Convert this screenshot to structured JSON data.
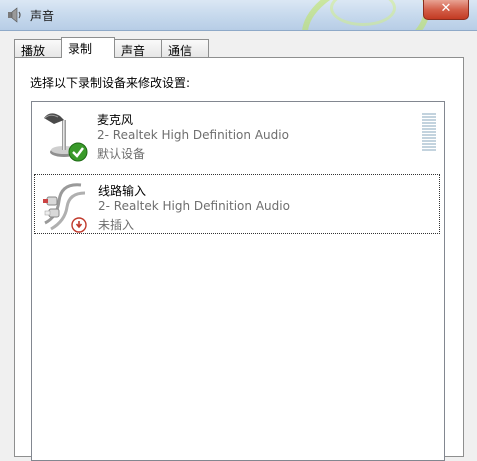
{
  "window": {
    "title": "声音",
    "close_label": "✕"
  },
  "tabs": [
    {
      "label": "播放",
      "active": false
    },
    {
      "label": "录制",
      "active": true
    },
    {
      "label": "声音",
      "active": false
    },
    {
      "label": "通信",
      "active": false
    }
  ],
  "instruction": "选择以下录制设备来修改设置:",
  "devices": [
    {
      "name": "麦克风",
      "description": "2- Realtek High Definition Audio",
      "status": "默认设备",
      "icon": "microphone-icon",
      "badge": "default-check-icon"
    },
    {
      "name": "线路输入",
      "description": "2- Realtek High Definition Audio",
      "status": "未插入",
      "icon": "line-in-cable-icon",
      "badge": "unplugged-icon"
    }
  ],
  "colors": {
    "check_badge": "#3a9a2a",
    "unplugged_badge": "#c0392b",
    "meter": "#c3d3de",
    "close_button": "#c23a23"
  }
}
